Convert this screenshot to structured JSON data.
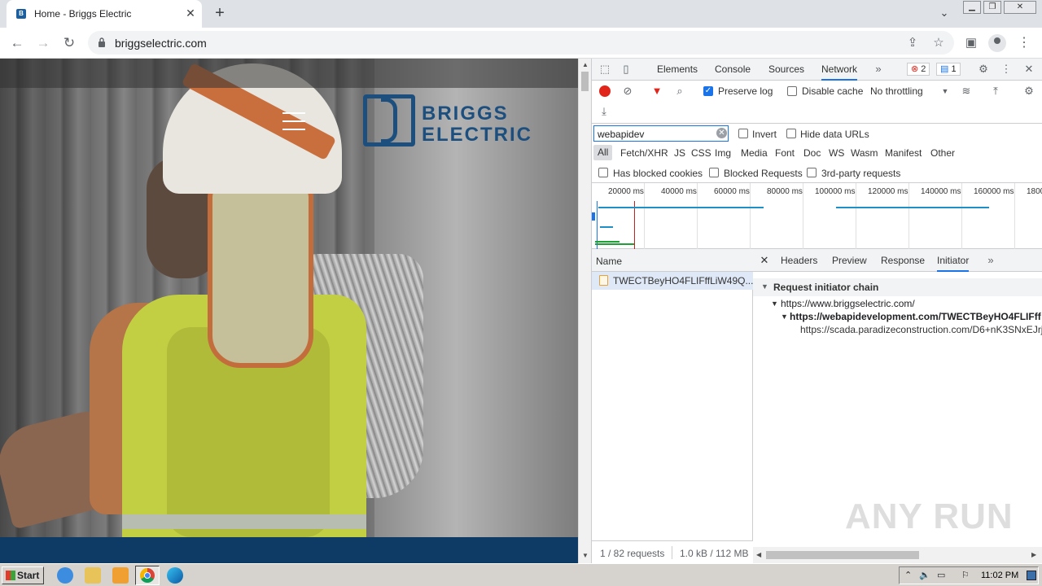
{
  "browser": {
    "tab_title": "Home - Briggs Electric",
    "url": "briggselectric.com"
  },
  "site": {
    "logo_line1": "BRIGGS",
    "logo_line2": "ELECTRIC",
    "brand_color": "#1d4f7e",
    "footer_color": "#0d3b66"
  },
  "devtools": {
    "tabs": [
      "Elements",
      "Console",
      "Sources",
      "Network"
    ],
    "active_tab": "Network",
    "error_count": "2",
    "message_count": "1",
    "preserve_log_label": "Preserve log",
    "preserve_log_checked": true,
    "disable_cache_label": "Disable cache",
    "throttling": "No throttling",
    "filter_value": "webapidev",
    "invert_label": "Invert",
    "hide_data_urls_label": "Hide data URLs",
    "filter_types": [
      "All",
      "Fetch/XHR",
      "JS",
      "CSS",
      "Img",
      "Media",
      "Font",
      "Doc",
      "WS",
      "Wasm",
      "Manifest",
      "Other"
    ],
    "has_blocked_cookies_label": "Has blocked cookies",
    "blocked_requests_label": "Blocked Requests",
    "third_party_label": "3rd-party requests",
    "timeline_labels": [
      "20000 ms",
      "40000 ms",
      "60000 ms",
      "80000 ms",
      "100000 ms",
      "120000 ms",
      "140000 ms",
      "160000 ms",
      "1800"
    ],
    "name_header": "Name",
    "request_name": "TWECTBeyHO4FLIFffLiW49Q...",
    "status_requests": "1 / 82 requests",
    "status_size": "1.0 kB / 112 MB",
    "detail_tabs": [
      "Headers",
      "Preview",
      "Response",
      "Initiator"
    ],
    "active_detail_tab": "Initiator",
    "initiator_heading": "Request initiator chain",
    "chain": [
      "https://www.briggselectric.com/",
      "https://webapidevelopment.com/TWECTBeyHO4FLIFff",
      "https://scada.paradizeconstruction.com/D6+nK3SNxEJrj"
    ]
  },
  "taskbar": {
    "start_label": "Start",
    "clock": "11:02 PM"
  },
  "watermark": "ANY RUN"
}
